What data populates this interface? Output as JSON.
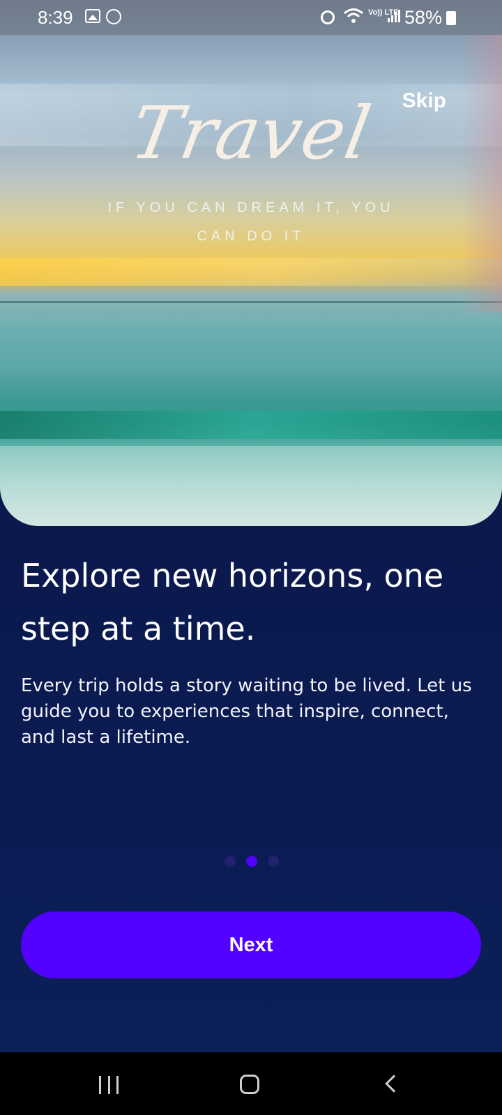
{
  "status_bar": {
    "time": "8:39",
    "network": "Vo)) LTE",
    "battery": "58%",
    "icons": [
      "image-icon",
      "face-icon",
      "alarm-icon",
      "wifi-icon",
      "volte-icon",
      "signal-icon",
      "battery-icon"
    ]
  },
  "hero": {
    "title": "Travel",
    "tagline": "IF YOU CAN DREAM IT, YOU CAN DO IT",
    "skip_label": "Skip"
  },
  "onboarding": {
    "headline": "Explore new horizons, one step at a time.",
    "body": "Every trip holds a story waiting to be lived. Let us guide you to experiences that inspire, connect, and last a lifetime.",
    "page_count": 3,
    "current_page": 2,
    "next_label": "Next"
  },
  "colors": {
    "background": "#0b1a4f",
    "accent": "#5200ff",
    "dot_inactive": "#21226e",
    "text": "#ffffff"
  },
  "nav_bar": {
    "icons": [
      "recent-apps-icon",
      "home-icon",
      "back-icon"
    ]
  }
}
